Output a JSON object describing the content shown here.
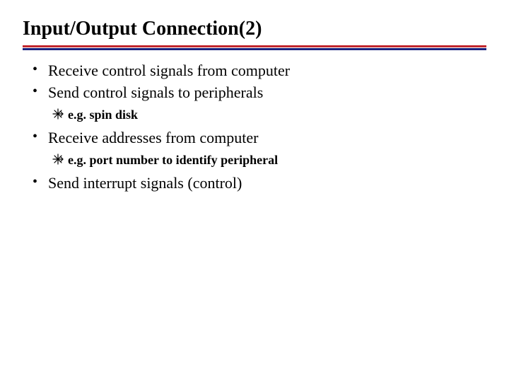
{
  "title": "Input/Output Connection(2)",
  "bullets": {
    "b0": "Receive control signals from computer",
    "b1": "Send control signals to peripherals",
    "b1_sub": "e.g. spin disk",
    "b2": "Receive addresses from computer",
    "b2_sub": "e.g. port number to identify peripheral",
    "b3": "Send interrupt signals (control)"
  }
}
